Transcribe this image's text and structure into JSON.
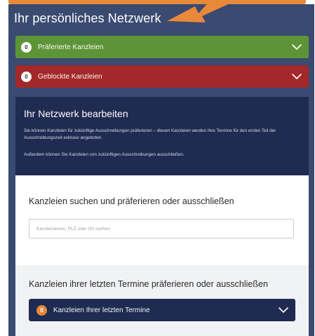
{
  "network": {
    "title": "Ihr persönliches Netzwerk",
    "preferred": {
      "count": "0",
      "label": "Präferierte Kanzleien"
    },
    "blocked": {
      "count": "0",
      "label": "Geblockte Kanzleien"
    }
  },
  "edit": {
    "title": "Ihr Netzwerk bearbeiten",
    "desc1": "Sie können Kanzleien für zukünftige Ausschreibungen präferieren – diesen Kanzleien werden Ihre Termine für den ersten Teil der Ausschreibungszeit exklusiv angeboten.",
    "desc2": "Außerdem können Sie Kanzleien von zukünftigen Ausschreibungen ausschließen."
  },
  "search": {
    "title": "Kanzleien suchen und präferieren oder ausschließen",
    "placeholder": "Kanzleinamen, PLZ oder Ort suchen",
    "value": ""
  },
  "recent": {
    "title": "Kanzleien ihrer letzten Termine präferieren oder ausschließen",
    "count": "0",
    "label": "Kanzleien Ihrer letzten Termine"
  },
  "colors": {
    "panel": "#3a4a70",
    "preferred": "#5e9438",
    "blocked": "#a3282a",
    "navy": "#1f2b50",
    "accent": "#e8893a"
  },
  "icons": {
    "accordion_toggle": "chevron-down-icon"
  }
}
